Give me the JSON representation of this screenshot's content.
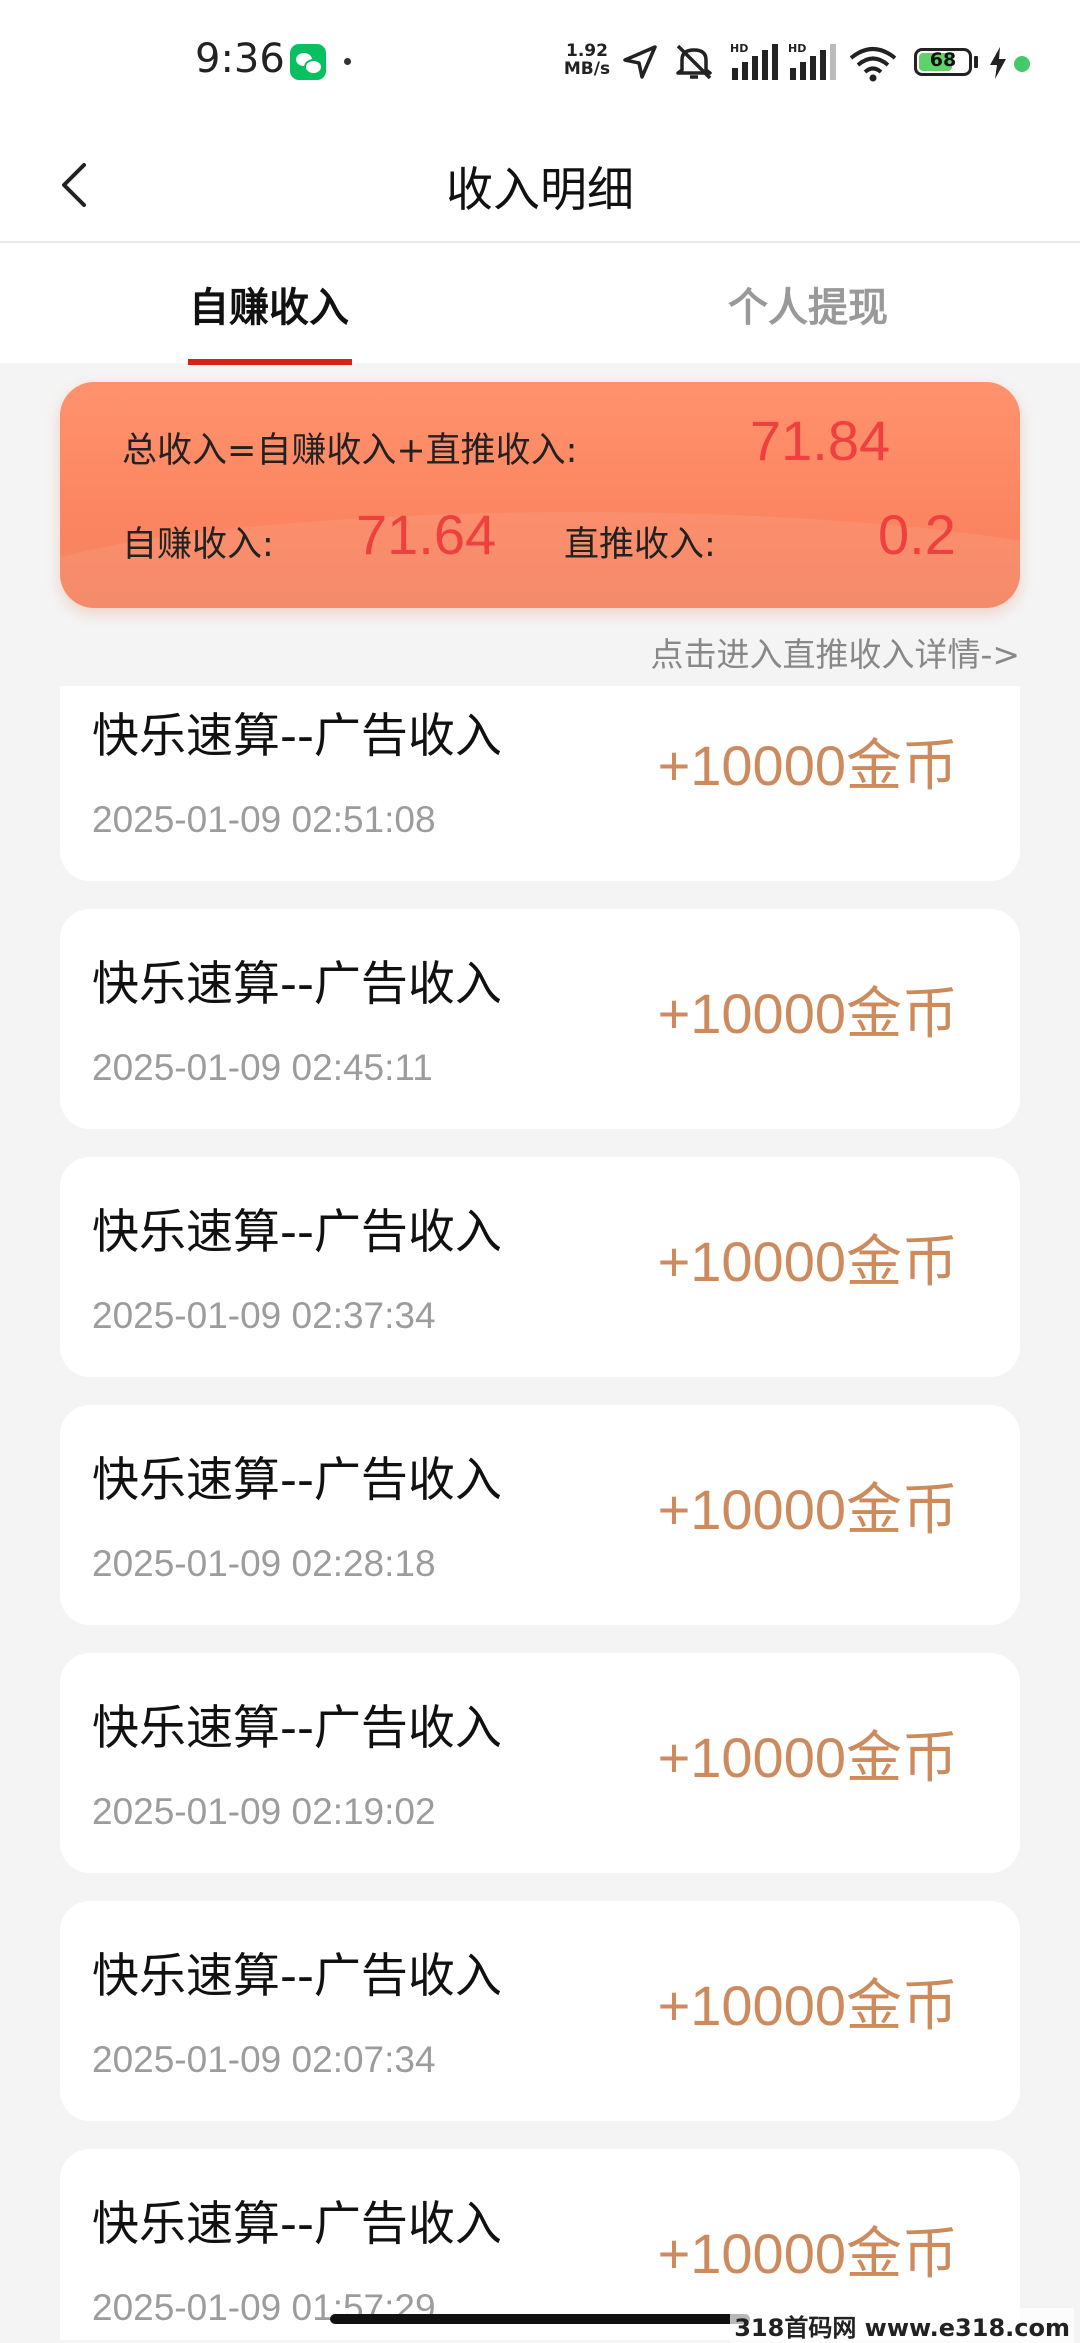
{
  "status_bar": {
    "time": "9:36",
    "net_speed_value": "1.92",
    "net_speed_unit": "MB/s",
    "battery": "68",
    "battery_level": 0.68,
    "icons": [
      "wechat-icon",
      "location-icon",
      "mute-icon",
      "signal-icon",
      "signal-icon",
      "wifi-icon",
      "battery-icon",
      "charging-icon"
    ]
  },
  "header": {
    "title": "收入明细",
    "back_icon": "chevron-left-icon"
  },
  "tabs": [
    {
      "label": "自赚收入",
      "active": true
    },
    {
      "label": "个人提现",
      "active": false
    }
  ],
  "summary": {
    "total_label": "总收入=自赚收入+直推收入:",
    "total_value": "71.84",
    "self_label": "自赚收入:",
    "self_value": "71.64",
    "direct_label": "直推收入:",
    "direct_value": "0.2"
  },
  "detail_link": "点击进入直推收入详情->",
  "records": [
    {
      "title": "快乐速算--广告收入",
      "time": "2025-01-09 02:51:08",
      "amount": "+10000金币"
    },
    {
      "title": "快乐速算--广告收入",
      "time": "2025-01-09 02:45:11",
      "amount": "+10000金币"
    },
    {
      "title": "快乐速算--广告收入",
      "time": "2025-01-09 02:37:34",
      "amount": "+10000金币"
    },
    {
      "title": "快乐速算--广告收入",
      "time": "2025-01-09 02:28:18",
      "amount": "+10000金币"
    },
    {
      "title": "快乐速算--广告收入",
      "time": "2025-01-09 02:19:02",
      "amount": "+10000金币"
    },
    {
      "title": "快乐速算--广告收入",
      "time": "2025-01-09 02:07:34",
      "amount": "+10000金币"
    },
    {
      "title": "快乐速算--广告收入",
      "time": "2025-01-09 01:57:29",
      "amount": "+10000金币"
    }
  ],
  "watermark": "318首码网 www.e318.com",
  "colors": {
    "accent_red": "#d91e1e",
    "card_orange": "#fb8560",
    "value_red": "#ef3f3f",
    "amount_brown": "#cd8a5d"
  }
}
